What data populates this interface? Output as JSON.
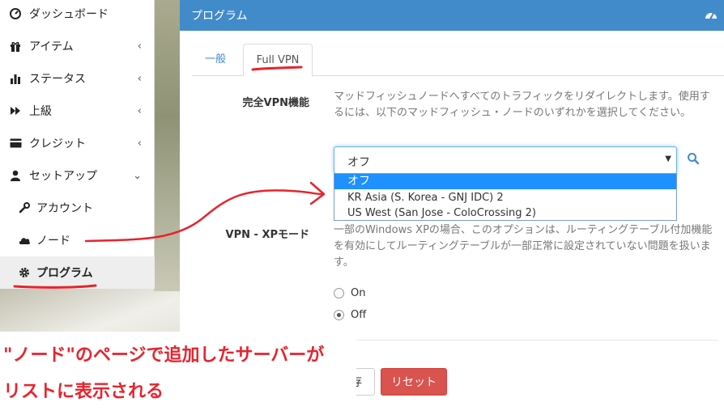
{
  "sidebar": {
    "items": [
      {
        "label": "ダッシュボード",
        "icon": "dashboard-icon",
        "chevron": ""
      },
      {
        "label": "アイテム",
        "icon": "gift-icon",
        "chevron": "‹"
      },
      {
        "label": "ステータス",
        "icon": "bar-chart-icon",
        "chevron": "‹"
      },
      {
        "label": "上級",
        "icon": "fast-forward-icon",
        "chevron": "‹"
      },
      {
        "label": "クレジット",
        "icon": "credit-card-icon",
        "chevron": "‹"
      },
      {
        "label": "セットアップ",
        "icon": "user-icon",
        "chevron": "⌄"
      },
      {
        "label": "アカウント",
        "icon": "wrench-icon",
        "chevron": ""
      },
      {
        "label": "ノード",
        "icon": "cloud-icon",
        "chevron": ""
      },
      {
        "label": "プログラム",
        "icon": "gear-icon",
        "chevron": ""
      }
    ]
  },
  "panel": {
    "title": "プログラム"
  },
  "tabs": {
    "general": "一般",
    "fullvpn": "Full VPN"
  },
  "fullvpn": {
    "label": "完全VPN機能",
    "help": "マッドフィッシュノードへすべてのトラフィックをリダイレクトします。使用するには、以下のマッドフィッシュ・ノードのいずれかを選択してください。",
    "select_value": "オフ",
    "caret": "▼",
    "options": [
      "オフ",
      "KR Asia (S. Korea - GNJ IDC) 2",
      "US West (San Jose - ColoCrossing 2)"
    ]
  },
  "xp_mode": {
    "label": "VPN - XPモード",
    "help": "一部のWindows XPの場合、このオプションは、ルーティングテーブル付加機能を有効にしてルーティングテーブルが一部正常に設定されていない問題を扱います。",
    "on_label": "On",
    "off_label": "Off",
    "selected": "Off"
  },
  "buttons": {
    "save": "存",
    "reset": "リセット"
  },
  "annotation": {
    "line1": "\"ノード\"のページで追加したサーバーが",
    "line2": "リストに表示される"
  },
  "colors": {
    "header": "#428bca",
    "annotation": "#e8232d",
    "reset": "#d9534f",
    "option_selected": "#1e90ff"
  }
}
